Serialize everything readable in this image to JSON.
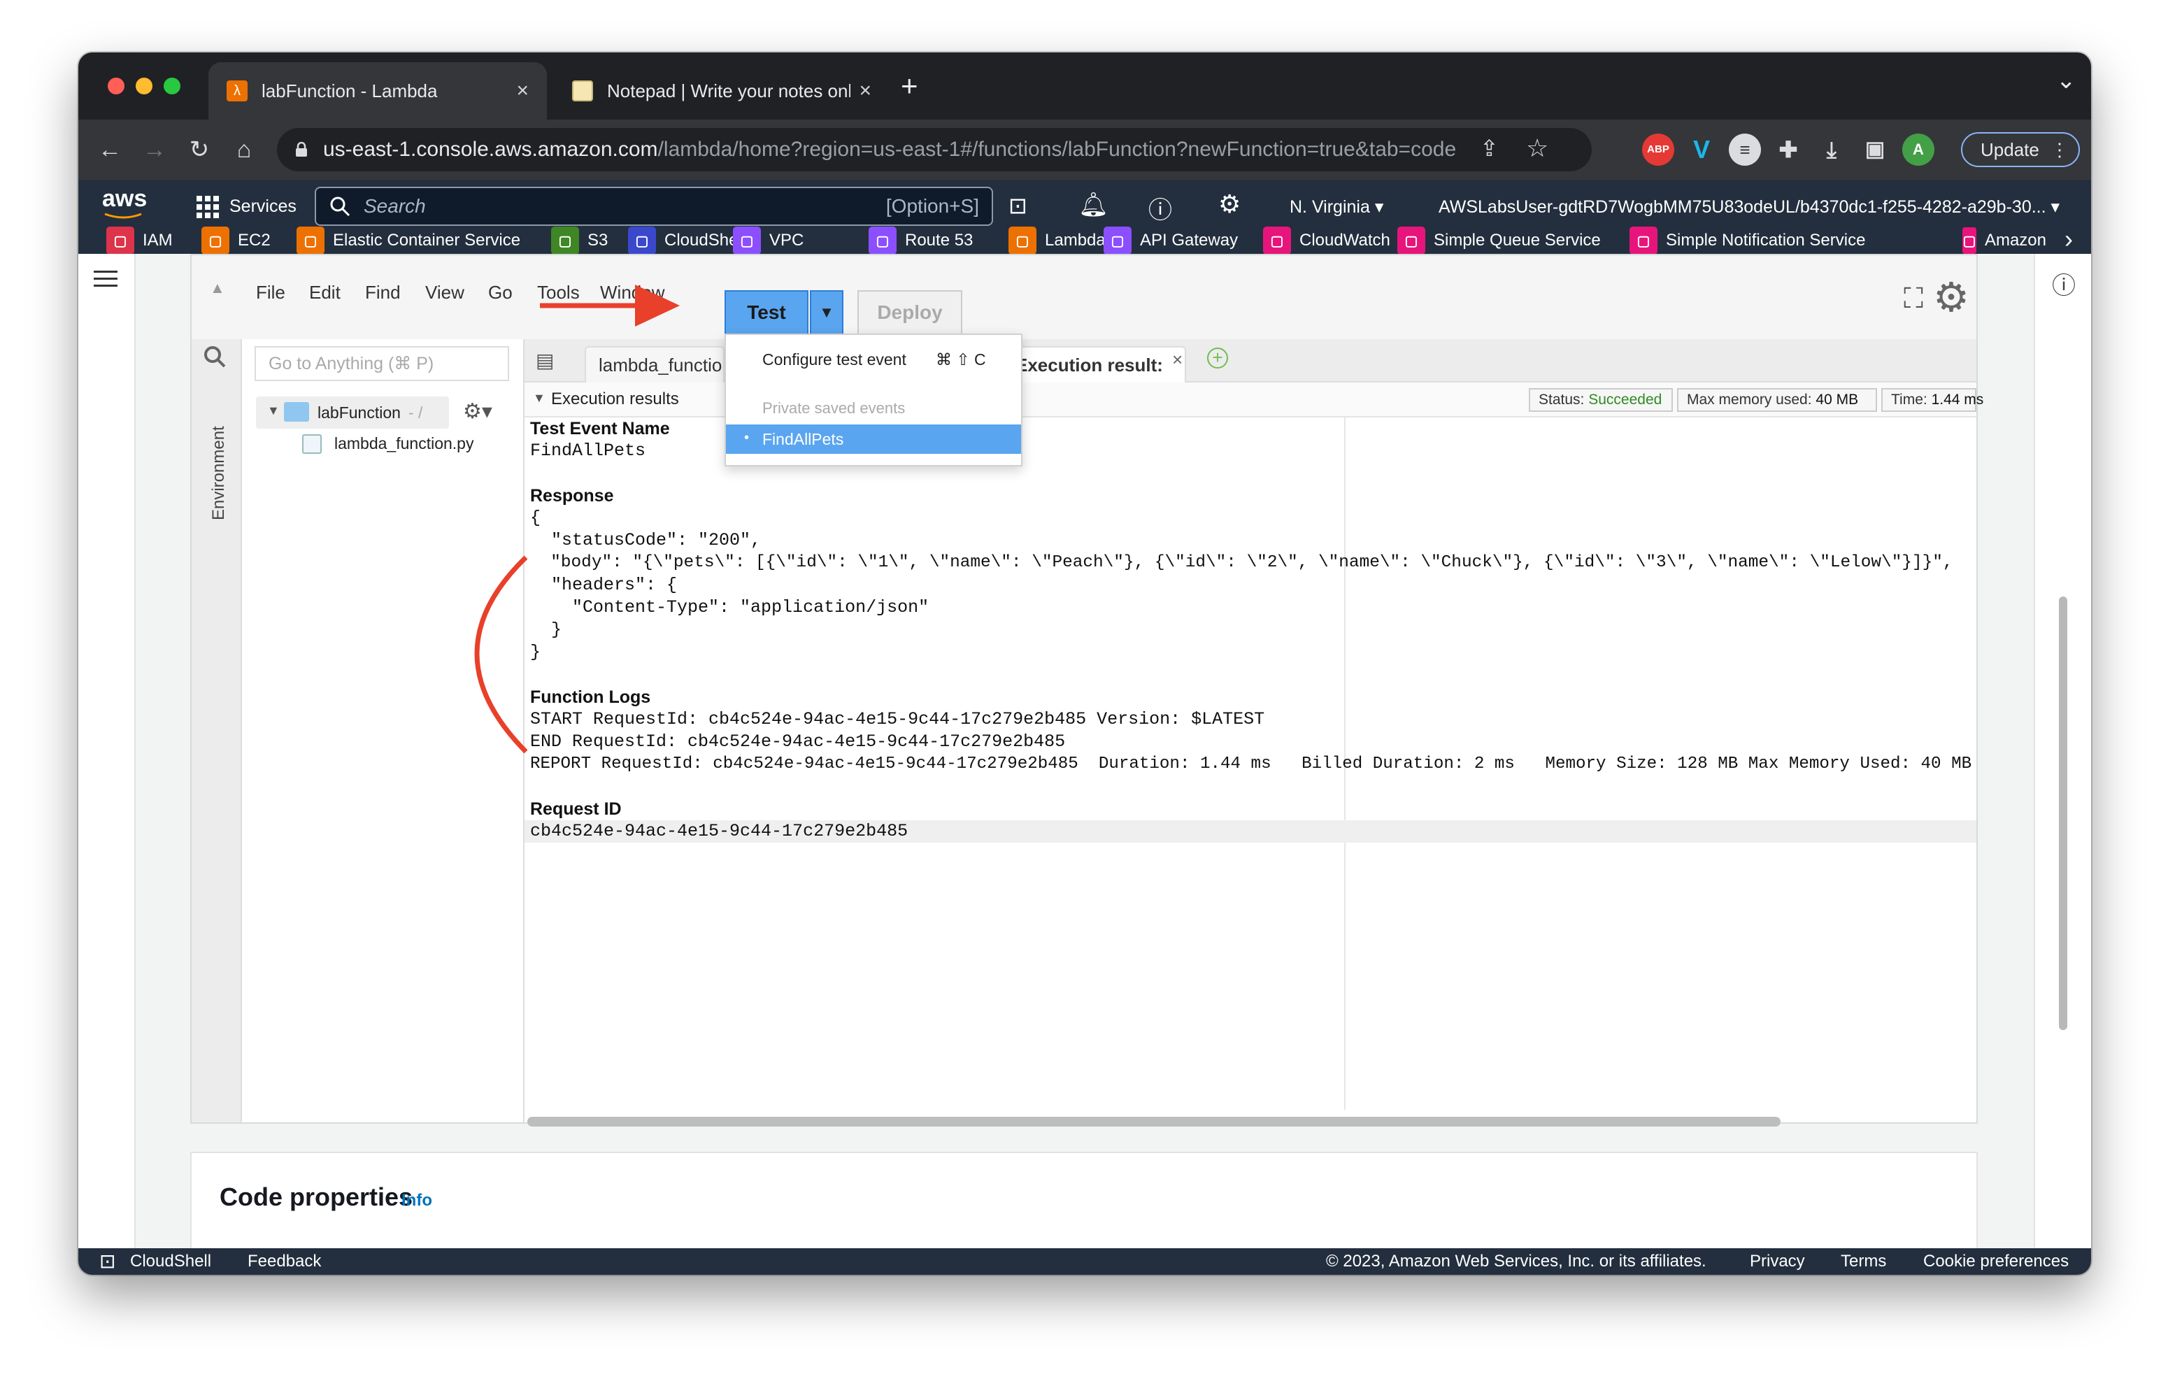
{
  "browser": {
    "tabs": [
      {
        "title": "labFunction - Lambda",
        "close": "×"
      },
      {
        "title": "Notepad | Write your notes online",
        "close": "×"
      }
    ],
    "new_tab": "+",
    "chevron": "⌄",
    "url_domain": "us-east-1.console.aws.amazon.com",
    "url_path": "/lambda/home?region=us-east-1#/functions/labFunction?newFunction=true&tab=code",
    "profile_initial": "A",
    "update_label": "Update"
  },
  "aws_nav": {
    "logo": "aws",
    "services_label": "Services",
    "search_placeholder": "Search",
    "search_shortcut": "[Option+S]",
    "region": "N. Virginia",
    "account": "AWSLabsUser-gdtRD7WogbMM75U83odeUL/b4370dc1-f255-4282-a29b-30...",
    "favorites": [
      {
        "label": "IAM",
        "color": "#dd344c"
      },
      {
        "label": "EC2",
        "color": "#ed7100"
      },
      {
        "label": "Elastic Container Service",
        "color": "#ed7100"
      },
      {
        "label": "S3",
        "color": "#3f8624"
      },
      {
        "label": "CloudShell",
        "color": "#3b48cc"
      },
      {
        "label": "VPC",
        "color": "#8c4fff"
      },
      {
        "label": "Route 53",
        "color": "#8c4fff"
      },
      {
        "label": "Lambda",
        "color": "#ed7100"
      },
      {
        "label": "API Gateway",
        "color": "#8c4fff"
      },
      {
        "label": "CloudWatch",
        "color": "#e7157b"
      },
      {
        "label": "Simple Queue Service",
        "color": "#e7157b"
      },
      {
        "label": "Simple Notification Service",
        "color": "#e7157b"
      },
      {
        "label": "Amazon",
        "color": "#e7157b"
      }
    ]
  },
  "ide": {
    "menu": [
      "File",
      "Edit",
      "Find",
      "View",
      "Go",
      "Tools",
      "Window"
    ],
    "test_label": "Test",
    "deploy_label": "Deploy",
    "goto_placeholder": "Go to Anything (⌘ P)",
    "environment_label": "Environment",
    "tree": {
      "folder": "labFunction",
      "folder_suffix": "- /",
      "file": "lambda_function.py"
    },
    "file_tabs": [
      "lambda_functio",
      "Execution result:"
    ],
    "results_header": "Execution results",
    "status_label": "Status:",
    "status_value": "Succeeded",
    "max_memory_label": "Max memory used:",
    "max_memory_value": "40 MB",
    "time_label": "Time:",
    "time_value": "1.44 ms",
    "test_event_name_label": "Test Event Name",
    "test_event_name": "FindAllPets",
    "response_label": "Response",
    "response_lines": [
      "{",
      "  \"statusCode\": \"200\",",
      "  \"body\": \"{\\\"pets\\\": [{\\\"id\\\": \\\"1\\\", \\\"name\\\": \\\"Peach\\\"}, {\\\"id\\\": \\\"2\\\", \\\"name\\\": \\\"Chuck\\\"}, {\\\"id\\\": \\\"3\\\", \\\"name\\\": \\\"Lelow\\\"}]}\",",
      "  \"headers\": {",
      "    \"Content-Type\": \"application/json\"",
      "  }",
      "}"
    ],
    "function_logs_label": "Function Logs",
    "log_lines": [
      "START RequestId: cb4c524e-94ac-4e15-9c44-17c279e2b485 Version: $LATEST",
      "END RequestId: cb4c524e-94ac-4e15-9c44-17c279e2b485",
      "REPORT RequestId: cb4c524e-94ac-4e15-9c44-17c279e2b485  Duration: 1.44 ms   Billed Duration: 2 ms   Memory Size: 128 MB Max Memory Used: 40 MB"
    ],
    "request_id_label": "Request ID",
    "request_id": "cb4c524e-94ac-4e15-9c44-17c279e2b485"
  },
  "test_dropdown": {
    "configure_label": "Configure test event",
    "configure_shortcut": "⌘ ⇧ C",
    "private_header": "Private saved events",
    "selected_event": "FindAllPets"
  },
  "code_properties": {
    "title": "Code properties",
    "info": "Info"
  },
  "footer": {
    "cloudshell": "CloudShell",
    "feedback": "Feedback",
    "copyright": "© 2023, Amazon Web Services, Inc. or its affiliates.",
    "privacy": "Privacy",
    "terms": "Terms",
    "cookies": "Cookie preferences"
  }
}
